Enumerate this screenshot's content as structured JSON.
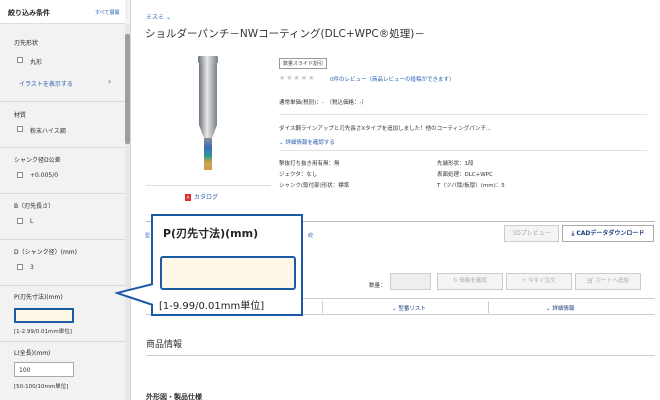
{
  "sidebar": {
    "title": "絞り込み条件",
    "expand_all": "すべて展開",
    "sections": {
      "blade_shape": {
        "label": "刃先形状",
        "option": "丸形",
        "link": "イラストを表示する"
      },
      "material": {
        "label": "材質",
        "option": "粉末ハイス鋼"
      },
      "shank_tol": {
        "label": "シャンク径D公差",
        "option": "+0.005/0"
      },
      "b_dim": {
        "label": "B（刃先長さ）",
        "option": "L"
      },
      "d_dim": {
        "label": "D（シャンク径）(mm)",
        "option": "3"
      },
      "p_dim": {
        "label": "P(刃先寸法)(mm)",
        "value": "",
        "hint": "[1-2.99/0.01mm単位]"
      },
      "l_dim": {
        "label": "L(全長)(mm)",
        "value": "100",
        "hint": "[50-100/10mm単位]"
      }
    }
  },
  "main": {
    "breadcrumb": "ミスミ",
    "title": "ショルダーパンチ－NWコーティング(DLC+WPC®処理)－",
    "catalog": "カタログ",
    "tag": "数量スライド割引",
    "stars": "★★★★★",
    "review": "0件のレビュー（商品レビューの投稿ができます）",
    "price": "通常単価(税別)：-　（税込価格：-）",
    "description": "ダイス鋼ラインアップと刃先長さXタイプを追加しました！他のコーティングパンチ...",
    "detail_link": "詳細情報を確認する",
    "specs_left": [
      "撃抜打ち抜き用有無：無",
      "ジェクタ：なし",
      "シャンク(取付部)形状：標準"
    ],
    "specs_right": [
      "先端形状：1段",
      "表面処理：DLC+WPC",
      "T（ツバ厚/板厚）(mm)：5"
    ],
    "btn_3d": "3Dプレビュー",
    "btn_cad": "CADデータダウンロード",
    "qty_label": "数量：",
    "btn_confirm": "価格を確認",
    "btn_order": "今すぐ注文",
    "btn_cart": "カートへ追加",
    "tab_model_list": "型番リスト",
    "tab_detail": "詳細情報",
    "section_title": "商品情報",
    "outline_title": "外形図・製品仕様",
    "ribbon_a": "型",
    "ribbon_b": "絞"
  },
  "callout": {
    "title": "P(刃先寸法)(mm)",
    "value": "",
    "hint": "[1-9.99/0.01mm単位]"
  },
  "colors": {
    "accent": "#1c5aa6",
    "link": "#2a5fb4",
    "input_focus_bg": "#fff8e6"
  }
}
